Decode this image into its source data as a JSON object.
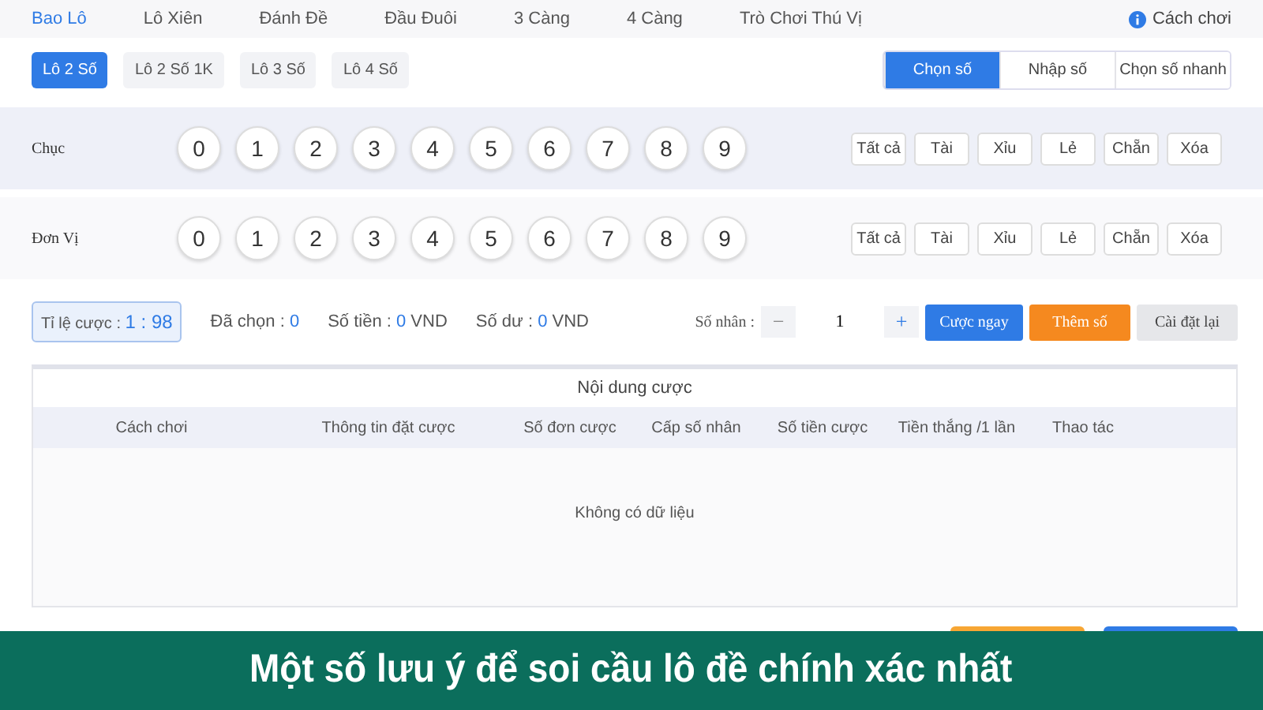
{
  "tabs": [
    {
      "label": "Bao Lô",
      "selected": true
    },
    {
      "label": "Lô Xiên",
      "selected": false
    },
    {
      "label": "Đánh Đề",
      "selected": false
    },
    {
      "label": "Đầu Đuôi",
      "selected": false
    },
    {
      "label": "3 Càng",
      "selected": false
    },
    {
      "label": "4 Càng",
      "selected": false
    },
    {
      "label": "Trò Chơi Thú Vị",
      "selected": false
    }
  ],
  "help_link": "Cách chơi",
  "subtabs": [
    {
      "label": "Lô 2 Số",
      "selected": true
    },
    {
      "label": "Lô 2 Số 1K",
      "selected": false
    },
    {
      "label": "Lô 3 Số",
      "selected": false
    },
    {
      "label": "Lô 4 Số",
      "selected": false
    }
  ],
  "modes": [
    {
      "label": "Chọn số",
      "selected": true
    },
    {
      "label": "Nhập số",
      "selected": false
    },
    {
      "label": "Chọn số nhanh",
      "selected": false
    }
  ],
  "digit_rows": [
    {
      "label": "Chục",
      "digits": [
        "0",
        "1",
        "2",
        "3",
        "4",
        "5",
        "6",
        "7",
        "8",
        "9"
      ],
      "quick": [
        "Tất cả",
        "Tài",
        "Xỉu",
        "Lẻ",
        "Chẵn",
        "Xóa"
      ]
    },
    {
      "label": "Đơn Vị",
      "digits": [
        "0",
        "1",
        "2",
        "3",
        "4",
        "5",
        "6",
        "7",
        "8",
        "9"
      ],
      "quick": [
        "Tất cả",
        "Tài",
        "Xỉu",
        "Lẻ",
        "Chẵn",
        "Xóa"
      ]
    }
  ],
  "odds": {
    "label": "Tỉ lệ cược : ",
    "value": "1 : 98"
  },
  "stats": [
    {
      "label": "Đã chọn : ",
      "value": "0"
    },
    {
      "label": "Số tiền : ",
      "value": "0",
      "unit": " VND"
    },
    {
      "label": "Số dư : ",
      "value": "0",
      "unit": " VND"
    }
  ],
  "multiplier": {
    "label": "Số nhân :",
    "minus": "−",
    "value": "1",
    "plus": "+"
  },
  "actions": [
    {
      "label": "Cược ngay",
      "kind": "primary"
    },
    {
      "label": "Thêm số",
      "kind": "warning"
    },
    {
      "label": "Cài đặt lại",
      "kind": "secondary"
    }
  ],
  "table": {
    "title": "Nội dung cược",
    "columns": [
      "Cách chơi",
      "Thông tin đặt cược",
      "Số đơn cược",
      "Cấp số nhân",
      "Số tiền cược",
      "Tiền thắng /1 lần",
      "Thao tác"
    ],
    "empty": "Không có dữ liệu"
  },
  "footer_buttons": [
    {
      "color": "#f7a634"
    },
    {
      "color": "#2f7be5"
    }
  ],
  "banner": "Một số lưu ý để soi cầu lô đề chính xác nhất"
}
